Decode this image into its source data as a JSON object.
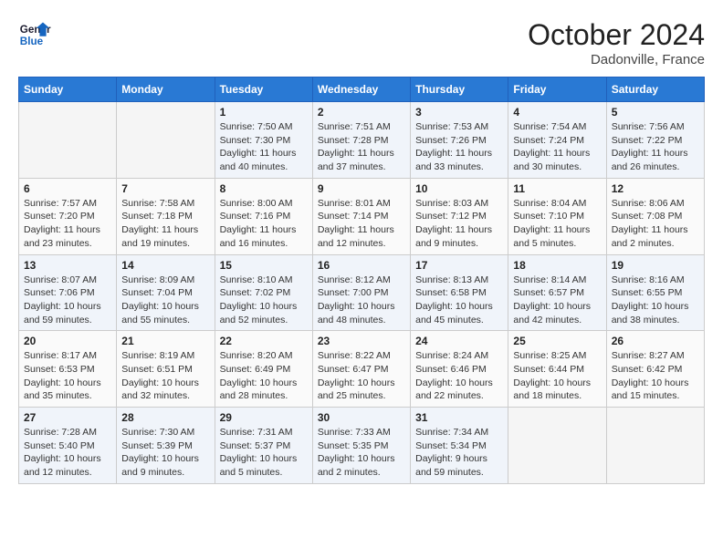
{
  "header": {
    "logo_line1": "General",
    "logo_line2": "Blue",
    "month": "October 2024",
    "location": "Dadonville, France"
  },
  "days_of_week": [
    "Sunday",
    "Monday",
    "Tuesday",
    "Wednesday",
    "Thursday",
    "Friday",
    "Saturday"
  ],
  "weeks": [
    [
      {
        "num": "",
        "info": ""
      },
      {
        "num": "",
        "info": ""
      },
      {
        "num": "1",
        "info": "Sunrise: 7:50 AM\nSunset: 7:30 PM\nDaylight: 11 hours and 40 minutes."
      },
      {
        "num": "2",
        "info": "Sunrise: 7:51 AM\nSunset: 7:28 PM\nDaylight: 11 hours and 37 minutes."
      },
      {
        "num": "3",
        "info": "Sunrise: 7:53 AM\nSunset: 7:26 PM\nDaylight: 11 hours and 33 minutes."
      },
      {
        "num": "4",
        "info": "Sunrise: 7:54 AM\nSunset: 7:24 PM\nDaylight: 11 hours and 30 minutes."
      },
      {
        "num": "5",
        "info": "Sunrise: 7:56 AM\nSunset: 7:22 PM\nDaylight: 11 hours and 26 minutes."
      }
    ],
    [
      {
        "num": "6",
        "info": "Sunrise: 7:57 AM\nSunset: 7:20 PM\nDaylight: 11 hours and 23 minutes."
      },
      {
        "num": "7",
        "info": "Sunrise: 7:58 AM\nSunset: 7:18 PM\nDaylight: 11 hours and 19 minutes."
      },
      {
        "num": "8",
        "info": "Sunrise: 8:00 AM\nSunset: 7:16 PM\nDaylight: 11 hours and 16 minutes."
      },
      {
        "num": "9",
        "info": "Sunrise: 8:01 AM\nSunset: 7:14 PM\nDaylight: 11 hours and 12 minutes."
      },
      {
        "num": "10",
        "info": "Sunrise: 8:03 AM\nSunset: 7:12 PM\nDaylight: 11 hours and 9 minutes."
      },
      {
        "num": "11",
        "info": "Sunrise: 8:04 AM\nSunset: 7:10 PM\nDaylight: 11 hours and 5 minutes."
      },
      {
        "num": "12",
        "info": "Sunrise: 8:06 AM\nSunset: 7:08 PM\nDaylight: 11 hours and 2 minutes."
      }
    ],
    [
      {
        "num": "13",
        "info": "Sunrise: 8:07 AM\nSunset: 7:06 PM\nDaylight: 10 hours and 59 minutes."
      },
      {
        "num": "14",
        "info": "Sunrise: 8:09 AM\nSunset: 7:04 PM\nDaylight: 10 hours and 55 minutes."
      },
      {
        "num": "15",
        "info": "Sunrise: 8:10 AM\nSunset: 7:02 PM\nDaylight: 10 hours and 52 minutes."
      },
      {
        "num": "16",
        "info": "Sunrise: 8:12 AM\nSunset: 7:00 PM\nDaylight: 10 hours and 48 minutes."
      },
      {
        "num": "17",
        "info": "Sunrise: 8:13 AM\nSunset: 6:58 PM\nDaylight: 10 hours and 45 minutes."
      },
      {
        "num": "18",
        "info": "Sunrise: 8:14 AM\nSunset: 6:57 PM\nDaylight: 10 hours and 42 minutes."
      },
      {
        "num": "19",
        "info": "Sunrise: 8:16 AM\nSunset: 6:55 PM\nDaylight: 10 hours and 38 minutes."
      }
    ],
    [
      {
        "num": "20",
        "info": "Sunrise: 8:17 AM\nSunset: 6:53 PM\nDaylight: 10 hours and 35 minutes."
      },
      {
        "num": "21",
        "info": "Sunrise: 8:19 AM\nSunset: 6:51 PM\nDaylight: 10 hours and 32 minutes."
      },
      {
        "num": "22",
        "info": "Sunrise: 8:20 AM\nSunset: 6:49 PM\nDaylight: 10 hours and 28 minutes."
      },
      {
        "num": "23",
        "info": "Sunrise: 8:22 AM\nSunset: 6:47 PM\nDaylight: 10 hours and 25 minutes."
      },
      {
        "num": "24",
        "info": "Sunrise: 8:24 AM\nSunset: 6:46 PM\nDaylight: 10 hours and 22 minutes."
      },
      {
        "num": "25",
        "info": "Sunrise: 8:25 AM\nSunset: 6:44 PM\nDaylight: 10 hours and 18 minutes."
      },
      {
        "num": "26",
        "info": "Sunrise: 8:27 AM\nSunset: 6:42 PM\nDaylight: 10 hours and 15 minutes."
      }
    ],
    [
      {
        "num": "27",
        "info": "Sunrise: 7:28 AM\nSunset: 5:40 PM\nDaylight: 10 hours and 12 minutes."
      },
      {
        "num": "28",
        "info": "Sunrise: 7:30 AM\nSunset: 5:39 PM\nDaylight: 10 hours and 9 minutes."
      },
      {
        "num": "29",
        "info": "Sunrise: 7:31 AM\nSunset: 5:37 PM\nDaylight: 10 hours and 5 minutes."
      },
      {
        "num": "30",
        "info": "Sunrise: 7:33 AM\nSunset: 5:35 PM\nDaylight: 10 hours and 2 minutes."
      },
      {
        "num": "31",
        "info": "Sunrise: 7:34 AM\nSunset: 5:34 PM\nDaylight: 9 hours and 59 minutes."
      },
      {
        "num": "",
        "info": ""
      },
      {
        "num": "",
        "info": ""
      }
    ]
  ]
}
